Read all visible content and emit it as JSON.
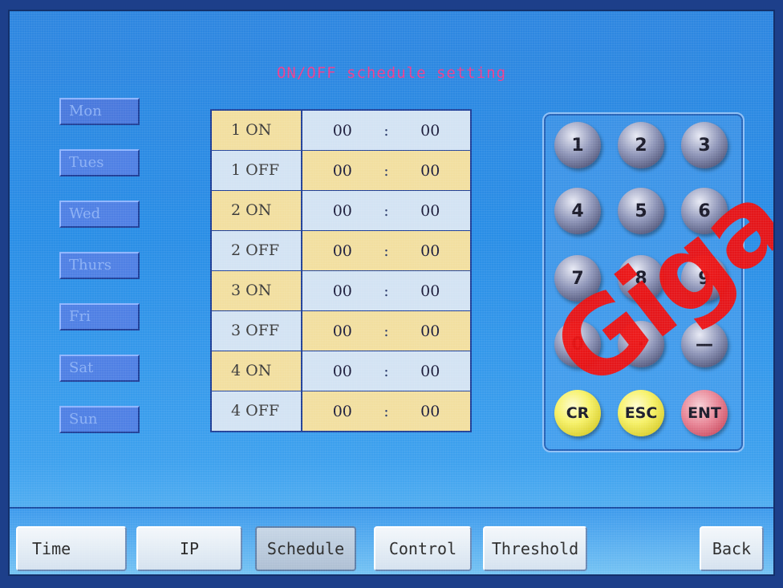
{
  "title": "ON/OFF schedule setting",
  "days": [
    "Mon",
    "Tues",
    "Wed",
    "Thurs",
    "Fri",
    "Sat",
    "Sun"
  ],
  "schedule": [
    {
      "label": "1  ON",
      "hour": "00",
      "sep": ":",
      "minute": "00"
    },
    {
      "label": "1  OFF",
      "hour": "00",
      "sep": ":",
      "minute": "00"
    },
    {
      "label": "2  ON",
      "hour": "00",
      "sep": ":",
      "minute": "00"
    },
    {
      "label": "2  OFF",
      "hour": "00",
      "sep": ":",
      "minute": "00"
    },
    {
      "label": "3  ON",
      "hour": "00",
      "sep": ":",
      "minute": "00"
    },
    {
      "label": "3  OFF",
      "hour": "00",
      "sep": ":",
      "minute": "00"
    },
    {
      "label": "4  ON",
      "hour": "00",
      "sep": ":",
      "minute": "00"
    },
    {
      "label": "4  OFF",
      "hour": "00",
      "sep": ":",
      "minute": "00"
    }
  ],
  "keypad": [
    "1",
    "2",
    "3",
    "4",
    "5",
    "6",
    "7",
    "8",
    "9",
    "0",
    "·",
    "—",
    "CR",
    "ESC",
    "ENT"
  ],
  "nav": {
    "time": "Time",
    "ip": "IP",
    "schedule": "Schedule",
    "control": "Control",
    "threshold": "Threshold",
    "back": "Back"
  },
  "watermark": "Giga",
  "colors": {
    "title": "#ef3d8f",
    "on_cell": "#f2dfa0",
    "off_cell": "#d3e3f3",
    "key_yellow": "#f7f26a",
    "key_red": "#e88596"
  }
}
